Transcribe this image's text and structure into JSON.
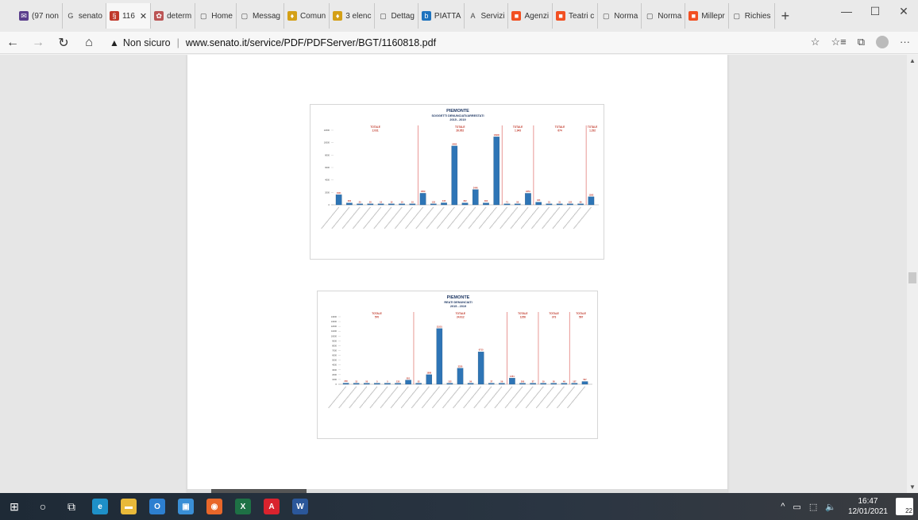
{
  "tabs": [
    {
      "label": "(97 non",
      "icon": "mail-icon",
      "color": "#5a3e8c",
      "glyph": "✉"
    },
    {
      "label": "senato",
      "icon": "google-icon",
      "color": "#ffffff",
      "glyph": "G"
    },
    {
      "label": "116",
      "icon": "senato-icon",
      "color": "#c0392b",
      "glyph": "§",
      "active": true
    },
    {
      "label": "determ",
      "icon": "seal-icon",
      "color": "#b55",
      "glyph": "✿"
    },
    {
      "label": "Home",
      "icon": "page-icon",
      "color": "#ffffff",
      "glyph": "▢"
    },
    {
      "label": "Messag",
      "icon": "page-icon",
      "color": "#ffffff",
      "glyph": "▢"
    },
    {
      "label": "Comun",
      "icon": "emblem-icon",
      "color": "#d4a017",
      "glyph": "♦"
    },
    {
      "label": "3 elenc",
      "icon": "emblem-icon",
      "color": "#d4a017",
      "glyph": "♦"
    },
    {
      "label": "Dettag",
      "icon": "page-icon",
      "color": "#ffffff",
      "glyph": "▢"
    },
    {
      "label": "PIATTA",
      "icon": "b-icon",
      "color": "#1e73be",
      "glyph": "b"
    },
    {
      "label": "Servizi",
      "icon": "a-icon",
      "color": "#ffffff",
      "glyph": "A"
    },
    {
      "label": "Agenzi",
      "icon": "windows-icon",
      "color": "#f25022",
      "glyph": "■"
    },
    {
      "label": "Teatri c",
      "icon": "windows-icon",
      "color": "#f25022",
      "glyph": "■"
    },
    {
      "label": "Norma",
      "icon": "page-icon",
      "color": "#ffffff",
      "glyph": "▢"
    },
    {
      "label": "Norma",
      "icon": "page-icon",
      "color": "#ffffff",
      "glyph": "▢"
    },
    {
      "label": "Millepr",
      "icon": "windows-icon",
      "color": "#f25022",
      "glyph": "■"
    },
    {
      "label": "Richies",
      "icon": "page-icon",
      "color": "#ffffff",
      "glyph": "▢"
    }
  ],
  "window": {
    "minimize": "—",
    "maximize": "☐",
    "close": "✕",
    "new_tab": "+"
  },
  "nav": {
    "back": "←",
    "forward": "→",
    "refresh": "↻",
    "home": "⌂",
    "warning": "▲",
    "security": "Non sicuro",
    "separator": "|",
    "url": "www.senato.it/service/PDF/PDFServer/BGT/1160818.pdf",
    "favorite": "☆",
    "favorites": "☆≡",
    "collections": "⧉",
    "more": "···"
  },
  "chart_data": [
    {
      "type": "bar",
      "title": "PIEMONTE",
      "subtitle": "SOGGETTI DENUNCIATI/ARRESTATI",
      "period": "2015 - 2019",
      "ylim": [
        0,
        12000
      ],
      "yticks": [
        0,
        2000,
        4000,
        6000,
        8000,
        10000,
        12000
      ],
      "groups": [
        {
          "label": "TOTALE",
          "value": "2.031"
        },
        {
          "label": "TOTALE",
          "value": "26.052"
        },
        {
          "label": "TOTALE",
          "value": "1.943"
        },
        {
          "label": "TOTALE",
          "value": "674"
        },
        {
          "label": "TOTALE",
          "value": "1.292"
        }
      ],
      "values": [
        1621,
        300,
        20,
        20,
        10,
        10,
        10,
        10,
        1859,
        132,
        315,
        9460,
        302,
        2446,
        302,
        10930,
        71,
        56,
        1851,
        424,
        31,
        31,
        122,
        60,
        1292
      ],
      "group_breaks": [
        8,
        16,
        19,
        24
      ]
    },
    {
      "type": "bar",
      "title": "PIEMONTE",
      "subtitle": "REATI DENUNCIATI",
      "period": "2015 - 2019",
      "ylim": [
        0,
        14000
      ],
      "yticks": [
        0,
        1000,
        2000,
        3000,
        4000,
        5000,
        6000,
        7000,
        8000,
        9000,
        10000,
        11000,
        12000,
        13000,
        14000
      ],
      "groups": [
        {
          "label": "TOTALE",
          "value": "570"
        },
        {
          "label": "TOTALE",
          "value": "24.912"
        },
        {
          "label": "TOTALE",
          "value": "1256"
        },
        {
          "label": "TOTALE",
          "value": "373"
        },
        {
          "label": "TOTALE",
          "value": "567"
        }
      ],
      "values": [
        230,
        12,
        50,
        5,
        5,
        135,
        851,
        52,
        1989,
        11551,
        122,
        3320,
        59,
        6715,
        37,
        59,
        1261,
        200,
        37,
        19,
        56,
        46,
        107,
        567
      ],
      "group_breaks": [
        7,
        16,
        19,
        22
      ]
    }
  ],
  "taskbar": {
    "start": "⊞",
    "search": "○",
    "taskview": "⧉",
    "apps": [
      {
        "name": "edge-icon",
        "color": "#1e90c8",
        "glyph": "e"
      },
      {
        "name": "folder-icon",
        "color": "#e8b93a",
        "glyph": "▬"
      },
      {
        "name": "outlook-icon",
        "color": "#2d7fd0",
        "glyph": "O"
      },
      {
        "name": "photos-icon",
        "color": "#3a8fd6",
        "glyph": "▣"
      },
      {
        "name": "firefox-icon",
        "color": "#e8672a",
        "glyph": "◉"
      },
      {
        "name": "excel-icon",
        "color": "#1e7145",
        "glyph": "X"
      },
      {
        "name": "acrobat-icon",
        "color": "#d9232e",
        "glyph": "A"
      },
      {
        "name": "word-icon",
        "color": "#2b579a",
        "glyph": "W"
      }
    ],
    "tray_arrow": "^",
    "tray_battery": "▭",
    "tray_network": "⬚",
    "tray_volume": "🔈",
    "time": "16:47",
    "date": "12/01/2021",
    "notifications": "22"
  }
}
